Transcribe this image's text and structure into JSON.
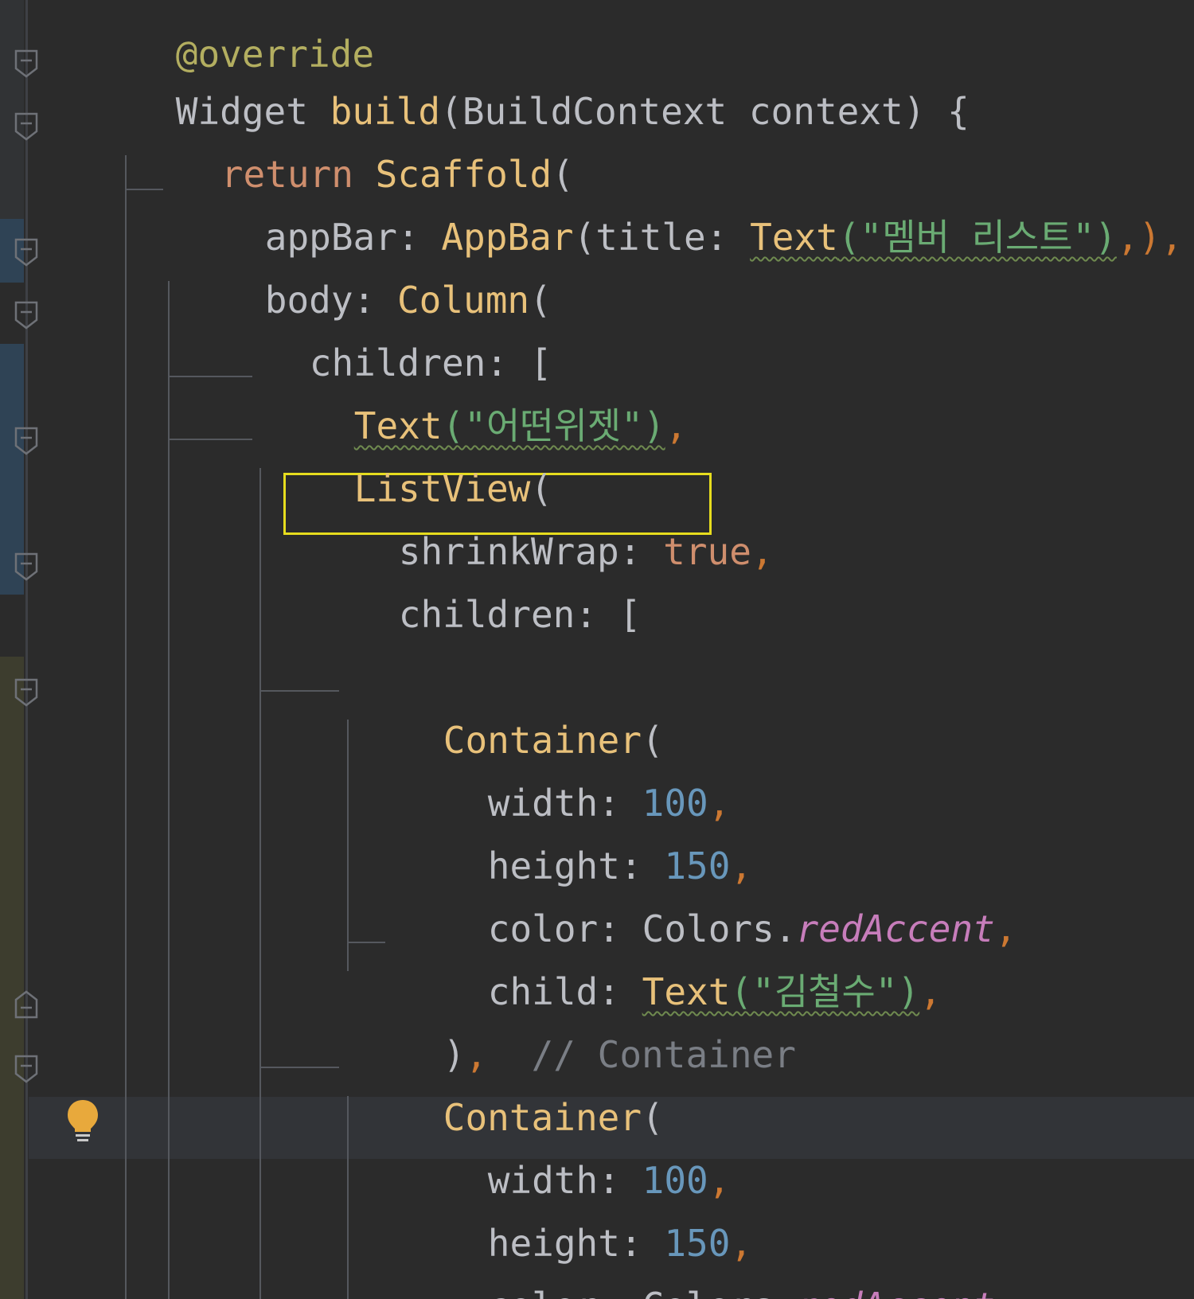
{
  "editor": {
    "lines": {
      "annotation": "@override",
      "build_widget": "Widget",
      "build_name": "build",
      "build_params": "(BuildContext context) {",
      "return_kw": "return",
      "scaffold": "Scaffold",
      "scaffold_paren": "(",
      "appbar_key": "appBar: ",
      "appbar_cls": "AppBar",
      "appbar_mid": "(title: ",
      "appbar_text": "Text",
      "appbar_str": "(\"멤버 리스트\")",
      "appbar_tail": ",),",
      "body_key": "body: ",
      "body_cls": "Column",
      "body_paren": "(",
      "children1": "children: [",
      "text_cls": "Text",
      "text_str": "(\"어떤위젯\")",
      "text_tail": ",",
      "listview_cls": "ListView",
      "listview_paren": "(",
      "shrink_key": "shrinkWrap: ",
      "shrink_val": "true",
      "shrink_tail": ",",
      "children2": "children: [",
      "container1": "Container",
      "container1_paren": "(",
      "width1_key": "width: ",
      "width1_val": "100",
      "width1_tail": ",",
      "height1_key": "height: ",
      "height1_val": "150",
      "height1_tail": ",",
      "color1_key": "color: ",
      "color1_cls": "Colors.",
      "color1_prop": "redAccent",
      "color1_tail": ",",
      "child1_key": "child: ",
      "child1_cls": "Text",
      "child1_str": "(\"김철수\")",
      "child1_tail": ",",
      "close1": ")",
      "close1_comma": ",",
      "close1_comment": "// Container",
      "container2": "Container",
      "container2_paren": "(",
      "width2_key": "width: ",
      "width2_val": "100",
      "width2_tail": ",",
      "height2_key": "height: ",
      "height2_val": "150",
      "height2_tail": ",",
      "color2_key": "color: ",
      "color2_cls": "Colors.",
      "color2_prop": "redAccent",
      "color2_tail": ","
    }
  },
  "icons": {
    "fold": "fold-marker-icon",
    "bulb": "lightbulb-icon"
  },
  "colors": {
    "background": "#2b2b2b",
    "keyword": "#cf8e6d",
    "class": "#e8c17a",
    "string": "#6aab73",
    "number": "#6897bb",
    "property": "#c77dbb",
    "highlight_box": "#e6dc1e"
  }
}
